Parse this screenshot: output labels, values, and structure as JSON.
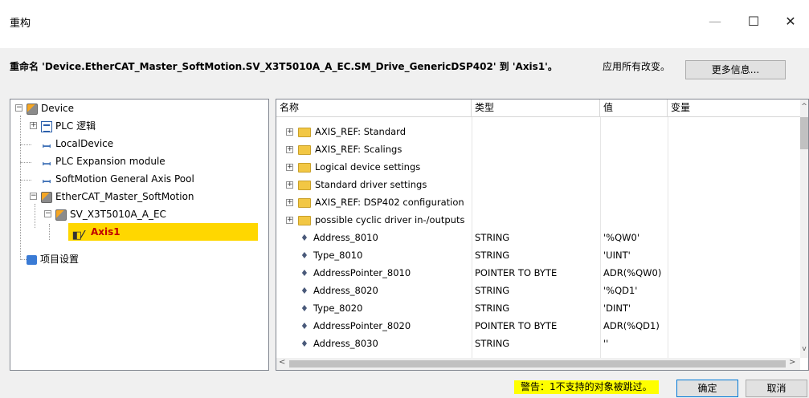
{
  "window": {
    "title": "重构",
    "minimize": "—",
    "maximize": "☐",
    "close": "✕"
  },
  "info": {
    "rename_message": "重命名 'Device.EtherCAT_Master_SoftMotion.SV_X3T5010A_A_EC.SM_Drive_GenericDSP402' 到 'Axis1'。",
    "apply_all": "应用所有改变。",
    "more_info_button": "更多信息..."
  },
  "tree": {
    "items": [
      {
        "label": "Device",
        "icon": "device-icon"
      },
      {
        "label": "PLC 逻辑",
        "icon": "plc-logic-icon"
      },
      {
        "label": "LocalDevice",
        "icon": "axis-icon"
      },
      {
        "label": "PLC Expansion module",
        "icon": "axis-icon"
      },
      {
        "label": "SoftMotion General Axis Pool",
        "icon": "axis-icon"
      },
      {
        "label": "EtherCAT_Master_SoftMotion",
        "icon": "device-icon"
      },
      {
        "label": "SV_X3T5010A_A_EC",
        "icon": "device-icon"
      },
      {
        "label": "Axis1",
        "icon": "axis-drive-icon",
        "selected": true
      },
      {
        "label": "项目设置",
        "icon": "project-settings-icon"
      }
    ]
  },
  "grid": {
    "columns": [
      "名称",
      "类型",
      "值",
      "变量"
    ],
    "rows": [
      {
        "name": "AXIS_REF: Standard",
        "type": "",
        "value": "",
        "folder": true
      },
      {
        "name": "AXIS_REF: Scalings",
        "type": "",
        "value": "",
        "folder": true
      },
      {
        "name": "Logical device settings",
        "type": "",
        "value": "",
        "folder": true
      },
      {
        "name": "Standard driver settings",
        "type": "",
        "value": "",
        "folder": true
      },
      {
        "name": "AXIS_REF: DSP402 configuration",
        "type": "",
        "value": "",
        "folder": true
      },
      {
        "name": "possible cyclic driver in-/outputs",
        "type": "",
        "value": "",
        "folder": true
      },
      {
        "name": "Address_8010",
        "type": "STRING",
        "value": "'%QW0'",
        "folder": false
      },
      {
        "name": "Type_8010",
        "type": "STRING",
        "value": "'UINT'",
        "folder": false
      },
      {
        "name": "AddressPointer_8010",
        "type": "POINTER TO BYTE",
        "value": "ADR(%QW0)",
        "folder": false
      },
      {
        "name": "Address_8020",
        "type": "STRING",
        "value": "'%QD1'",
        "folder": false
      },
      {
        "name": "Type_8020",
        "type": "STRING",
        "value": "'DINT'",
        "folder": false
      },
      {
        "name": "AddressPointer_8020",
        "type": "POINTER TO BYTE",
        "value": "ADR(%QD1)",
        "folder": false
      },
      {
        "name": "Address_8030",
        "type": "STRING",
        "value": "''",
        "folder": false
      }
    ]
  },
  "footer": {
    "warning": "警告：1不支持的对象被跳过。",
    "ok_button": "确定",
    "cancel_button": "取消"
  }
}
